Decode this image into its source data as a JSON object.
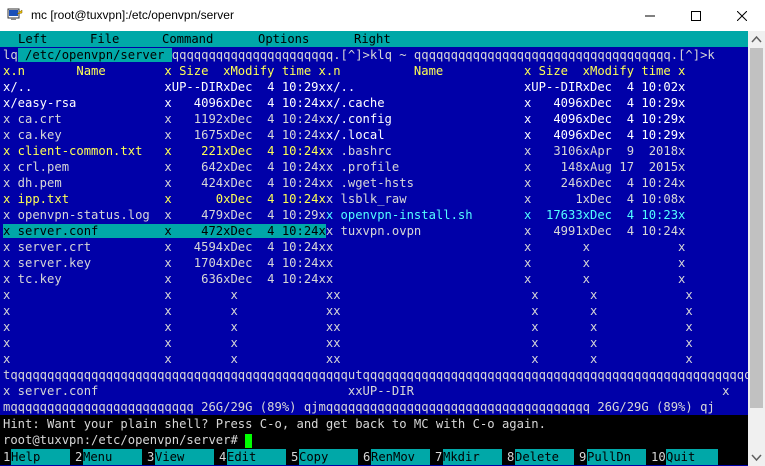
{
  "window": {
    "title": "mc [root@tuxvpn]:/etc/openvpn/server"
  },
  "menu": {
    "items": [
      "Left",
      "File",
      "Command",
      "Options",
      "Right"
    ]
  },
  "panels": {
    "left_header": "lq",
    "left_path": " /etc/openvpn/server ",
    "left_header_rest": "qqqqqqqqqqqqqqqqqqqqqq.[^]>kl",
    "right_header": "q ~ qqqqqqqqqqqqqqqqqqqqqqqqqqqqqqqqqqq.[^]>k",
    "columns_left": "x.n       Name        x Size  xModify time ",
    "columns_right": "x.n          Name           x Size  xModify time x",
    "rows": [
      {
        "l": "x/..                  xUP--DIRxDec  4 10:29x",
        "r": "x/..                       xUP--DIRxDec  4 10:02x"
      },
      {
        "l": "x/easy-rsa            x   4096xDec  4 10:24x",
        "r": "x/.cache                   x   4096xDec  4 10:29x"
      },
      {
        "l": "x ca.crt              x   1192xDec  4 10:24x",
        "r": "x/.config                  x   4096xDec  4 10:29x"
      },
      {
        "l": "x ca.key              x   1675xDec  4 10:24x",
        "r": "x/.local                   x   4096xDec  4 10:29x"
      },
      {
        "l": "x client-common.txt   x    221xDec  4 10:24x",
        "r": "x .bashrc                  x   3106xApr  9  2018x"
      },
      {
        "l": "x crl.pem             x    642xDec  4 10:24x",
        "r": "x .profile                 x    148xAug 17  2015x"
      },
      {
        "l": "x dh.pem              x    424xDec  4 10:24x",
        "r": "x .wget-hsts               x    246xDec  4 10:24x"
      },
      {
        "l": "x ipp.txt             x      0xDec  4 10:24x",
        "r": "x lsblk_raw                x      1xDec  4 10:08x"
      },
      {
        "l": "x openvpn-status.log  x    479xDec  4 10:29x",
        "r": "x openvpn-install.sh       x  17633xDec  4 10:23x"
      },
      {
        "l": "x server.conf         x    472xDec  4 10:24x",
        "r": "x tuxvpn.ovpn              x   4991xDec  4 10:24x"
      },
      {
        "l": "x server.crt          x   4594xDec  4 10:24x",
        "r": "x                          x       x            x"
      },
      {
        "l": "x server.key          x   1704xDec  4 10:24x",
        "r": "x                          x       x            x"
      },
      {
        "l": "x tc.key              x    636xDec  4 10:24x",
        "r": "x                          x       x            x"
      },
      {
        "l": "x                     x        x            x",
        "r": "x                          x       x            x"
      },
      {
        "l": "x                     x        x            x",
        "r": "x                          x       x            x"
      },
      {
        "l": "x                     x        x            x",
        "r": "x                          x       x            x"
      },
      {
        "l": "x                     x        x            x",
        "r": "x                          x       x            x"
      },
      {
        "l": "x                     x        x            x",
        "r": "x                          x       x            x"
      }
    ],
    "separator": "tqqqqqqqqqqqqqqqqqqqqqqqqqqqqqqqqqqqqqqqqqqqqqqutqqqqqqqqqqqqqqqqqqqqqqqqqqqqqqqqqqqqqqqqqqqqqqqqqqqqqqu",
    "left_status": "x server.conf                                  x",
    "right_status": "xUP--DIR                                          x",
    "left_footer": "mqqqqqqqqqqqqqqqqqqqqqqqqq 26G/29G (89%) qj",
    "right_footer": "mqqqqqqqqqqqqqqqqqqqqqqqqqqqqqqqqqqqq 26G/29G (89%) qj"
  },
  "hint": "Hint: Want your plain shell? Press C-o, and get back to MC with C-o again.",
  "prompt": "root@tuxvpn:/etc/openvpn/server# ",
  "function_keys": [
    {
      "num": "1",
      "label": "Help"
    },
    {
      "num": "2",
      "label": "Menu"
    },
    {
      "num": "3",
      "label": "View"
    },
    {
      "num": "4",
      "label": "Edit"
    },
    {
      "num": "5",
      "label": "Copy"
    },
    {
      "num": "6",
      "label": "RenMov"
    },
    {
      "num": "7",
      "label": "Mkdir"
    },
    {
      "num": "8",
      "label": "Delete"
    },
    {
      "num": "9",
      "label": "PullDn"
    },
    {
      "num": "10",
      "label": "Quit"
    }
  ],
  "colors": {
    "panel_bg": "#0000a8",
    "highlight": "#00a8a8",
    "text": "#d7d7d7",
    "executable": "#54ffff",
    "special": "#ffff54",
    "cursor": "#00ff00"
  }
}
